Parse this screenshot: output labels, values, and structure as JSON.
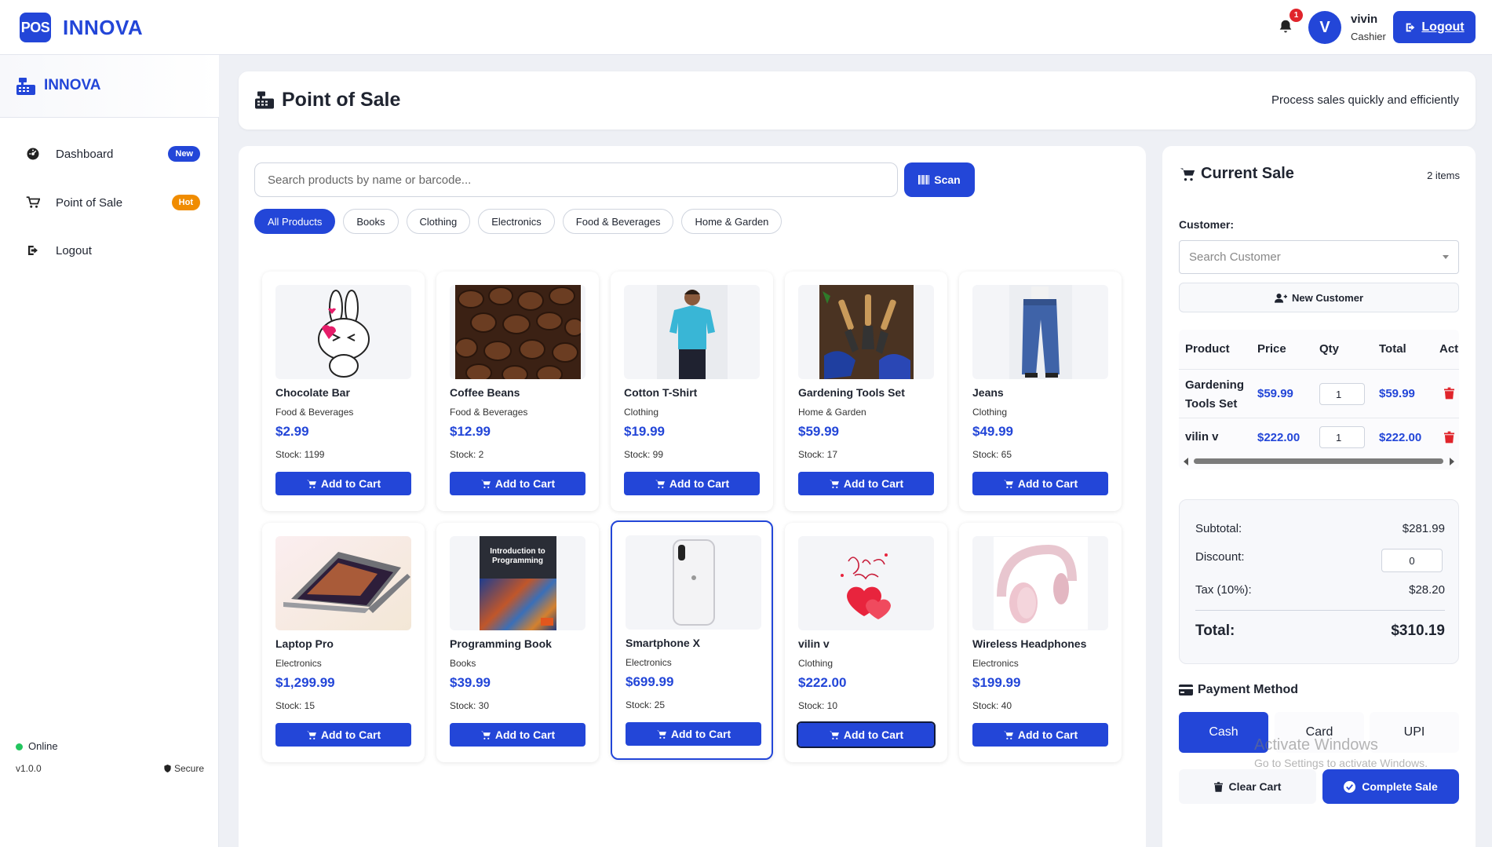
{
  "brand": {
    "badge": "POS",
    "name": "INNOVA"
  },
  "topbar": {
    "notification_count": "1",
    "avatar_initial": "V",
    "user_name": "vivin",
    "user_role": "Cashier",
    "logout_label": "Logout"
  },
  "sidebar": {
    "brand": "INNOVA",
    "items": [
      {
        "label": "Dashboard",
        "badge": "New",
        "icon": "dashboard-icon"
      },
      {
        "label": "Point of Sale",
        "badge": "Hot",
        "icon": "cart-icon"
      },
      {
        "label": "Logout",
        "badge": "",
        "icon": "logout-icon"
      }
    ],
    "status": "Online",
    "version": "v1.0.0",
    "secure": "Secure"
  },
  "header": {
    "title": "Point of Sale",
    "subtitle": "Process sales quickly and efficiently"
  },
  "search": {
    "placeholder": "Search products by name or barcode...",
    "scan_label": "Scan"
  },
  "categories": [
    "All Products",
    "Books",
    "Clothing",
    "Electronics",
    "Food & Beverages",
    "Home & Garden"
  ],
  "active_category": "All Products",
  "products": [
    {
      "name": "Chocolate Bar",
      "category": "Food & Beverages",
      "price": "$2.99",
      "stock": "Stock: 1199",
      "image": "sticker-bunny"
    },
    {
      "name": "Coffee Beans",
      "category": "Food & Beverages",
      "price": "$12.99",
      "stock": "Stock: 2",
      "image": "coffee-beans"
    },
    {
      "name": "Cotton T-Shirt",
      "category": "Clothing",
      "price": "$19.99",
      "stock": "Stock: 99",
      "image": "tshirt-model"
    },
    {
      "name": "Gardening Tools Set",
      "category": "Home & Garden",
      "price": "$59.99",
      "stock": "Stock: 17",
      "image": "garden-tools"
    },
    {
      "name": "Jeans",
      "category": "Clothing",
      "price": "$49.99",
      "stock": "Stock: 65",
      "image": "jeans"
    },
    {
      "name": "Laptop Pro",
      "category": "Electronics",
      "price": "$1,299.99",
      "stock": "Stock: 15",
      "image": "laptop"
    },
    {
      "name": "Programming Book",
      "category": "Books",
      "price": "$39.99",
      "stock": "Stock: 30",
      "image": "book-cover"
    },
    {
      "name": "Smartphone X",
      "category": "Electronics",
      "price": "$699.99",
      "stock": "Stock: 25",
      "image": "smartphone"
    },
    {
      "name": "vilin v",
      "category": "Clothing",
      "price": "$222.00",
      "stock": "Stock: 10",
      "image": "love-hearts"
    },
    {
      "name": "Wireless Headphones",
      "category": "Electronics",
      "price": "$199.99",
      "stock": "Stock: 40",
      "image": "headphones"
    }
  ],
  "add_to_cart_label": "Add to Cart",
  "book_cover_text": "Introduction to Programming",
  "cart": {
    "title": "Current Sale",
    "count": "2 items",
    "customer_label": "Customer:",
    "customer_placeholder": "Search Customer",
    "new_customer_label": "New Customer",
    "columns": [
      "Product",
      "Price",
      "Qty",
      "Total",
      "Act"
    ],
    "rows": [
      {
        "product": "Gardening Tools Set",
        "price": "$59.99",
        "qty": "1",
        "total": "$59.99"
      },
      {
        "product": "vilin v",
        "price": "$222.00",
        "qty": "1",
        "total": "$222.00"
      }
    ],
    "subtotal_label": "Subtotal:",
    "subtotal": "$281.99",
    "discount_label": "Discount:",
    "discount": "0",
    "tax_label": "Tax (10%):",
    "tax": "$28.20",
    "total_label": "Total:",
    "total": "$310.19",
    "payment_title": "Payment Method",
    "payment_methods": [
      "Cash",
      "Card",
      "UPI"
    ],
    "active_payment": "Cash",
    "clear_label": "Clear Cart",
    "complete_label": "Complete Sale"
  },
  "watermark": {
    "line1": "Activate Windows",
    "line2": "Go to Settings to activate Windows."
  },
  "colors": {
    "accent": "#2346d8",
    "danger": "#e0242b",
    "hot": "#f08c00",
    "online": "#22c55e"
  }
}
